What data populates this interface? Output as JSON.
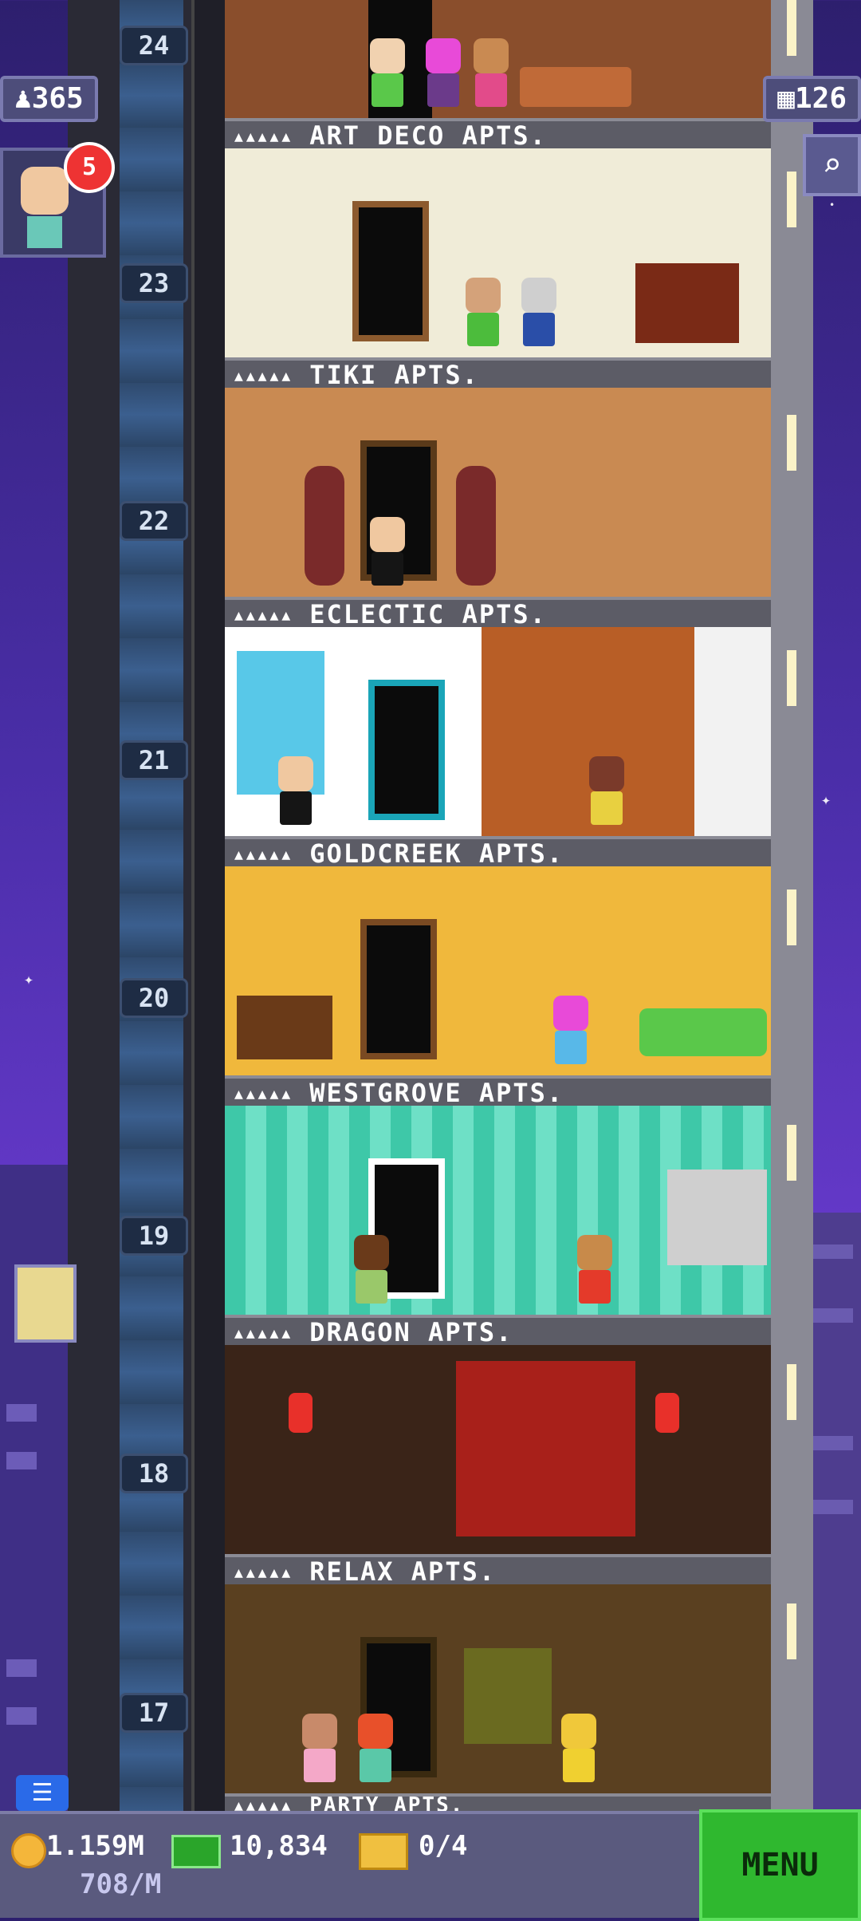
{
  "hud": {
    "population": "365",
    "floors": "126",
    "notification_count": "5"
  },
  "floors": [
    {
      "number": "24",
      "name": "ART DECO APTS."
    },
    {
      "number": "23",
      "name": "TIKI APTS."
    },
    {
      "number": "22",
      "name": "ECLECTIC APTS."
    },
    {
      "number": "21",
      "name": "GOLDCREEK APTS."
    },
    {
      "number": "20",
      "name": "WESTGROVE APTS."
    },
    {
      "number": "19",
      "name": "DRAGON APTS."
    },
    {
      "number": "18",
      "name": "RELAX APTS."
    },
    {
      "number": "17",
      "name": "PARTY APTS."
    }
  ],
  "bottom": {
    "coins": "1.159M",
    "bux": "10,834",
    "tickets": "0/4",
    "rate": "708/M",
    "menu_label": "MENU"
  },
  "icons": {
    "population": "person-icon",
    "floors": "building-icon",
    "search": "magnifier-icon",
    "coin": "coin-icon",
    "bux": "bux-icon",
    "ticket": "ticket-icon"
  },
  "colors": {
    "sky": "#4a2ea8",
    "menu": "#2fb82f"
  }
}
